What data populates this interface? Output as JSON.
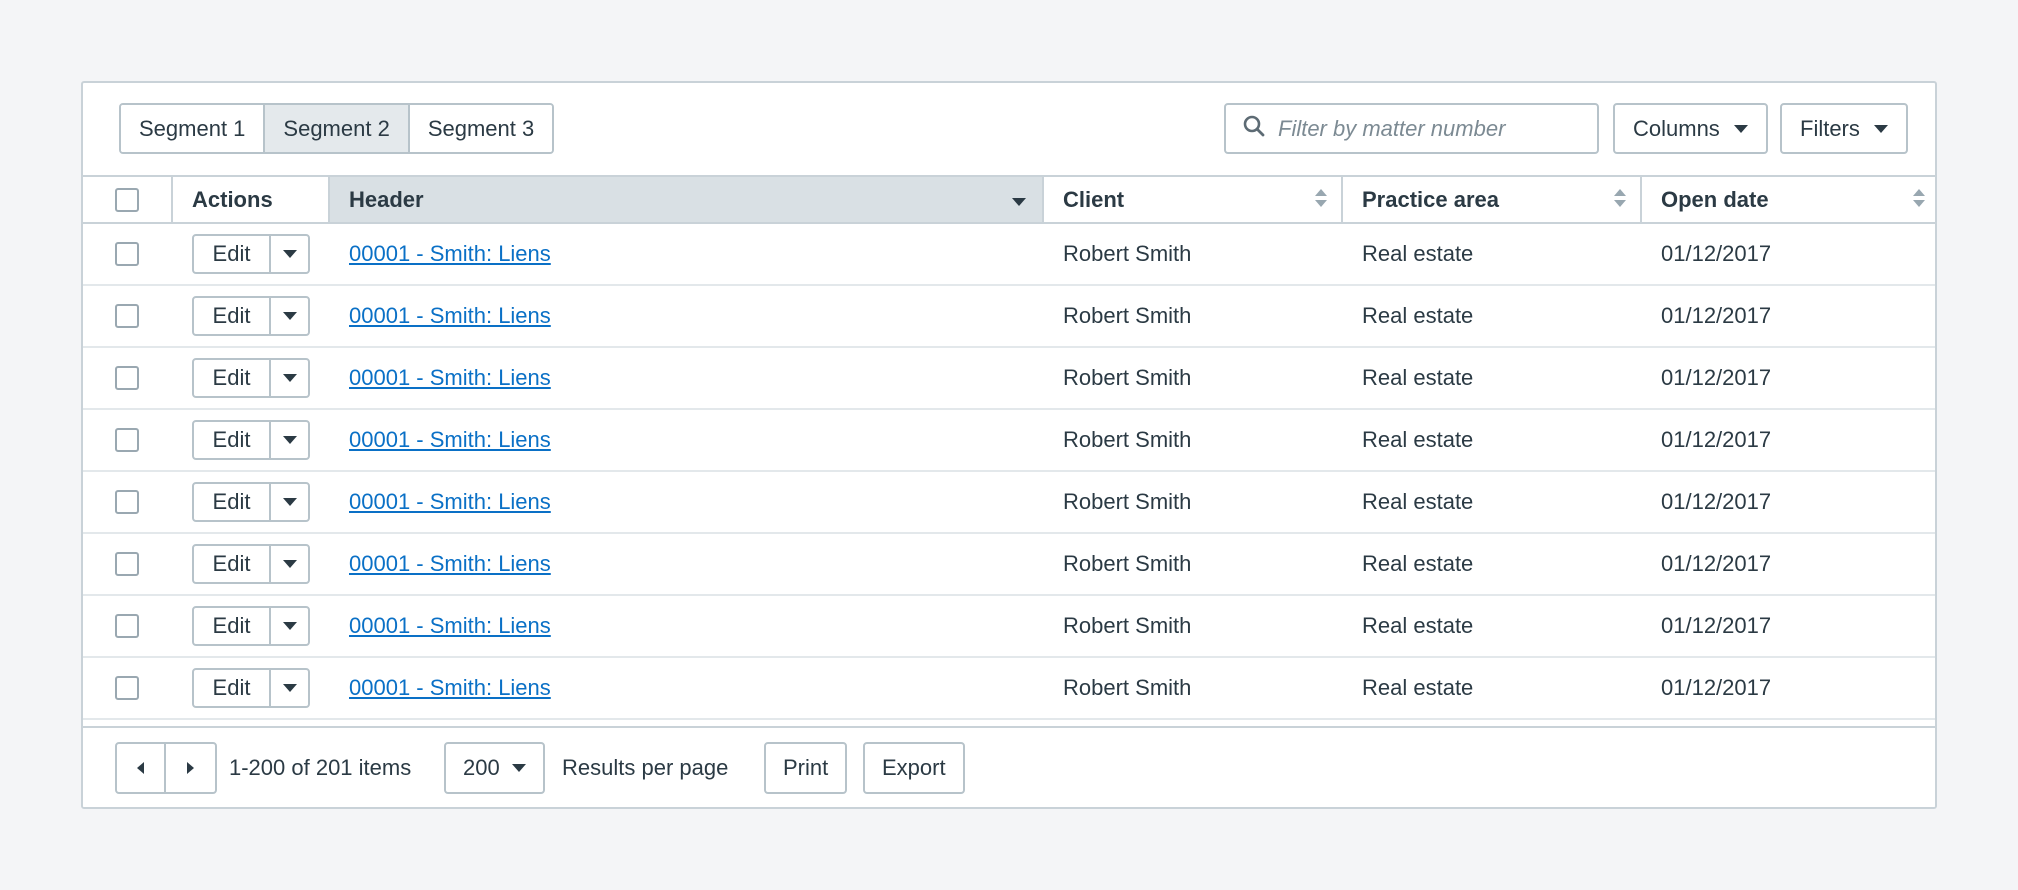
{
  "segments": [
    {
      "label": "Segment 1",
      "active": false
    },
    {
      "label": "Segment 2",
      "active": true
    },
    {
      "label": "Segment 3",
      "active": false
    }
  ],
  "search": {
    "placeholder": "Filter by matter number",
    "value": ""
  },
  "toolbar": {
    "columns_label": "Columns",
    "filters_label": "Filters"
  },
  "table": {
    "headers": {
      "actions": "Actions",
      "header": "Header",
      "client": "Client",
      "practice_area": "Practice area",
      "open_date": "Open date"
    },
    "sorted_column": "Header",
    "edit_label": "Edit",
    "rows": [
      {
        "matter": "00001 - Smith: Liens",
        "client": "Robert Smith",
        "practice_area": "Real estate",
        "open_date": "01/12/2017"
      },
      {
        "matter": "00001 - Smith: Liens",
        "client": "Robert Smith",
        "practice_area": "Real estate",
        "open_date": "01/12/2017"
      },
      {
        "matter": "00001 - Smith: Liens",
        "client": "Robert Smith",
        "practice_area": "Real estate",
        "open_date": "01/12/2017"
      },
      {
        "matter": "00001 - Smith: Liens",
        "client": "Robert Smith",
        "practice_area": "Real estate",
        "open_date": "01/12/2017"
      },
      {
        "matter": "00001 - Smith: Liens",
        "client": "Robert Smith",
        "practice_area": "Real estate",
        "open_date": "01/12/2017"
      },
      {
        "matter": "00001 - Smith: Liens",
        "client": "Robert Smith",
        "practice_area": "Real estate",
        "open_date": "01/12/2017"
      },
      {
        "matter": "00001 - Smith: Liens",
        "client": "Robert Smith",
        "practice_area": "Real estate",
        "open_date": "01/12/2017"
      },
      {
        "matter": "00001 - Smith: Liens",
        "client": "Robert Smith",
        "practice_area": "Real estate",
        "open_date": "01/12/2017"
      }
    ]
  },
  "footer": {
    "range_text": "1-200 of 201 items",
    "per_page_value": "200",
    "per_page_label": "Results per page",
    "print_label": "Print",
    "export_label": "Export"
  },
  "colors": {
    "link": "#0a70c6",
    "sorted_header_bg": "#d9e0e4",
    "border": "#c9d2d8",
    "text": "#2b3a44"
  }
}
